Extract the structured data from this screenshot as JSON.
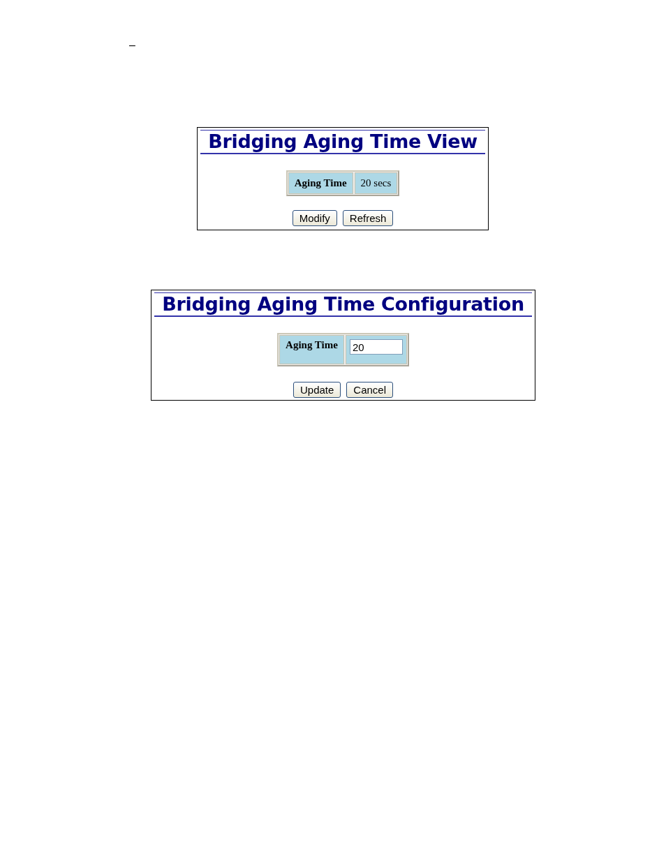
{
  "page_mark": "–",
  "panels": [
    {
      "kind": "view",
      "title": "Bridging Aging Time View",
      "label": "Aging Time",
      "value": "20 secs",
      "buttons": [
        "Modify",
        "Refresh"
      ]
    },
    {
      "kind": "config",
      "title": "Bridging Aging Time Configuration",
      "label": "Aging Time",
      "value": "20",
      "buttons": [
        "Update",
        "Cancel"
      ]
    }
  ]
}
